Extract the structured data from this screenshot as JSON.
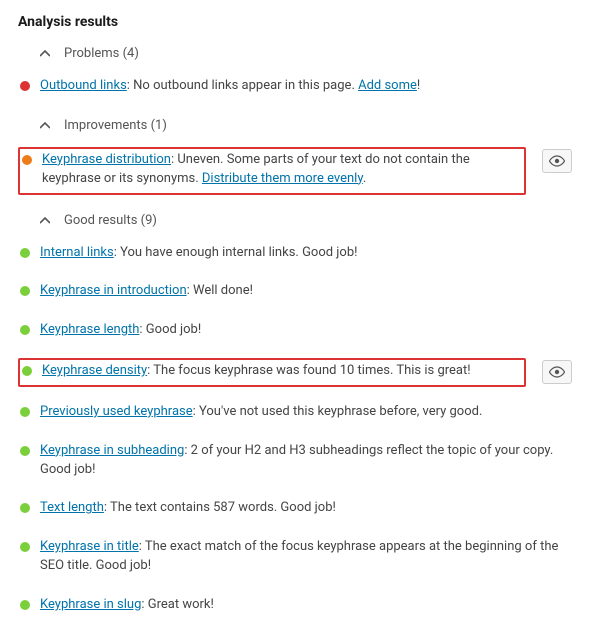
{
  "title": "Analysis results",
  "sections": {
    "problems": {
      "label": "Problems (4)"
    },
    "improvements": {
      "label": "Improvements (1)"
    },
    "good": {
      "label": "Good results (9)"
    }
  },
  "items": {
    "outbound_links": {
      "metric": "Outbound links",
      "text": ": No outbound links appear in this page. ",
      "action": "Add some",
      "tail": "!"
    },
    "keyphrase_distribution": {
      "metric": "Keyphrase distribution",
      "text": ": Uneven. Some parts of your text do not contain the keyphrase or its synonyms. ",
      "action": "Distribute them more evenly",
      "tail": "."
    },
    "internal_links": {
      "metric": "Internal links",
      "text": ": You have enough internal links. Good job!"
    },
    "keyphrase_intro": {
      "metric": "Keyphrase in introduction",
      "text": ": Well done!"
    },
    "keyphrase_length": {
      "metric": "Keyphrase length",
      "text": ": Good job!"
    },
    "keyphrase_density": {
      "metric": "Keyphrase density",
      "text": ": The focus keyphrase was found 10 times. This is great!"
    },
    "prev_keyphrase": {
      "metric": "Previously used keyphrase",
      "text": ": You've not used this keyphrase before, very good."
    },
    "keyphrase_subheading": {
      "metric": "Keyphrase in subheading",
      "text": ": 2 of your H2 and H3 subheadings reflect the topic of your copy. Good job!"
    },
    "text_length": {
      "metric": "Text length",
      "text": ": The text contains 587 words. Good job!"
    },
    "keyphrase_title": {
      "metric": "Keyphrase in title",
      "text": ": The exact match of the focus keyphrase appears at the beginning of the SEO title. Good job!"
    },
    "keyphrase_slug": {
      "metric": "Keyphrase in slug",
      "text": ": Great work!"
    }
  }
}
